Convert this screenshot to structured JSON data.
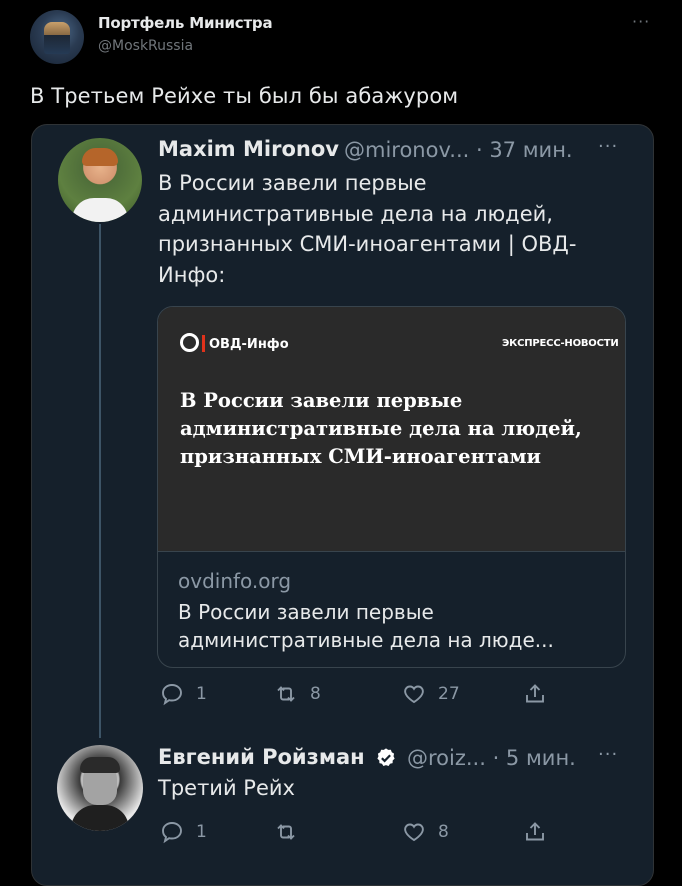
{
  "header": {
    "author_name": "Портфель Министра",
    "author_handle": "@MoskRussia",
    "more_label": "···"
  },
  "tweet": {
    "text": "В Третьем Рейхе ты был бы абажуром"
  },
  "quoted": {
    "author_name": "Maxim Mironov",
    "meta": "@mironov... · 37 мин.",
    "more_label": "···",
    "text": "В России завели первые административные дела на людей, признанных СМИ-иноагентами | ОВД-Инфо:",
    "card": {
      "logo_text": "ОВД-Инфо",
      "tag": "ЭКСПРЕСС-НОВОСТИ",
      "headline": "В России завели первые административные дела на людей, признанных СМИ-иноагентами",
      "domain": "ovdinfo.org",
      "title": "В России завели первые административные дела на люде..."
    },
    "actions": {
      "reply_count": "1",
      "retweet_count": "8",
      "like_count": "27",
      "share_count": ""
    }
  },
  "reply": {
    "author_name": "Евгений Ройзман",
    "meta": "@roiz... · 5 мин.",
    "more_label": "···",
    "text": "Третий Рейх",
    "actions": {
      "reply_count": "1",
      "retweet_count": "",
      "like_count": "8",
      "share_count": ""
    }
  },
  "colors": {
    "background": "#000000",
    "quote_background": "#15202b",
    "secondary_text": "#8b98a5",
    "verified": "#ffffff",
    "brand_red": "#e0321b"
  }
}
